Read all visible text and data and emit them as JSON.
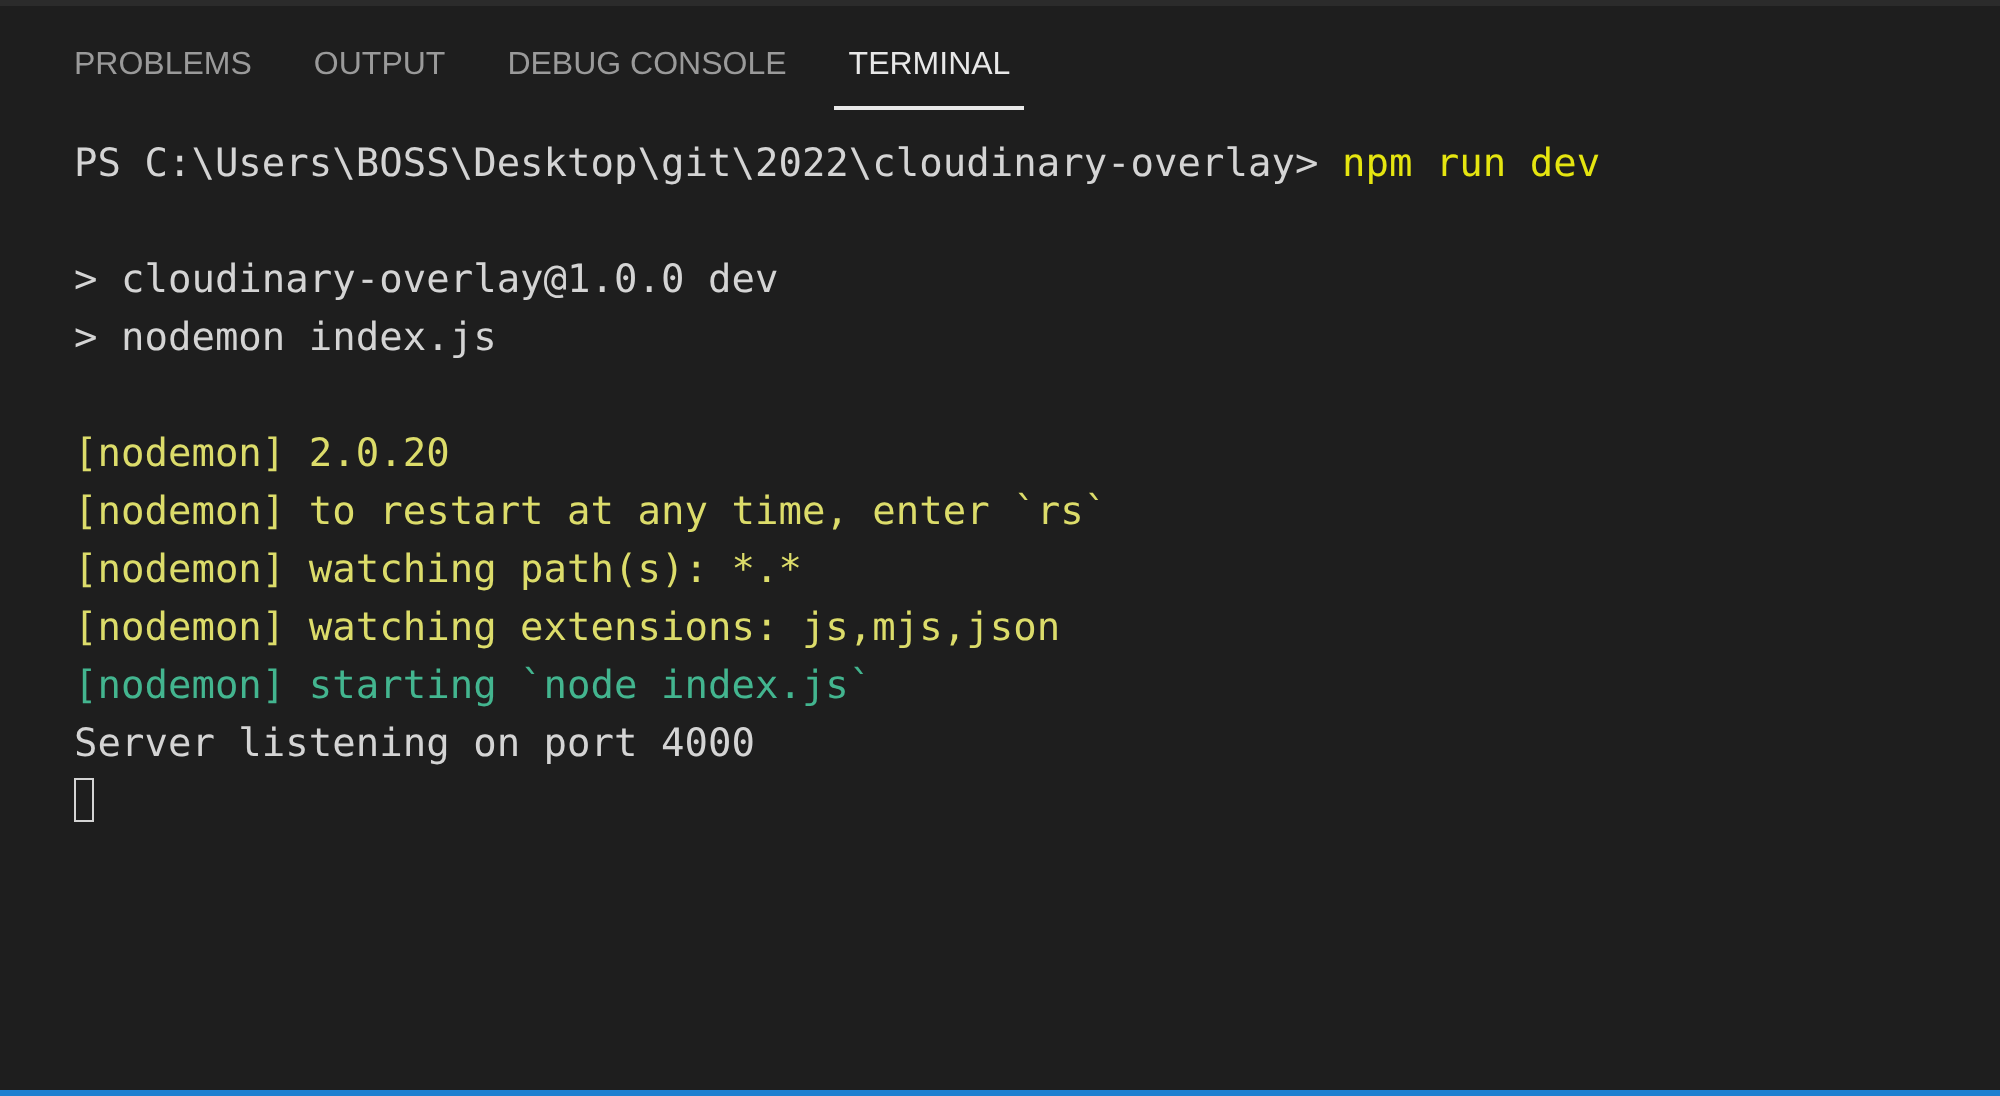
{
  "tabs": [
    {
      "label": "PROBLEMS",
      "selected": false
    },
    {
      "label": "OUTPUT",
      "selected": false
    },
    {
      "label": "DEBUG CONSOLE",
      "selected": false
    },
    {
      "label": "TERMINAL",
      "selected": true
    }
  ],
  "terminal": {
    "blocks": [
      [
        [
          {
            "kind": "prompt",
            "text": "PS C:\\Users\\BOSS\\Desktop\\git\\2022\\cloudinary-overlay> "
          },
          {
            "kind": "command",
            "text": "npm run dev"
          }
        ]
      ],
      [
        [
          {
            "kind": "plain",
            "text": "> cloudinary-overlay@1.0.0 dev"
          }
        ],
        [
          {
            "kind": "plain",
            "text": "> nodemon index.js"
          }
        ]
      ],
      [
        [
          {
            "kind": "warn",
            "text": "[nodemon] 2.0.20"
          }
        ],
        [
          {
            "kind": "warn",
            "text": "[nodemon] to restart at any time, enter `rs`"
          }
        ],
        [
          {
            "kind": "warn",
            "text": "[nodemon] watching path(s): *.*"
          }
        ],
        [
          {
            "kind": "warn",
            "text": "[nodemon] watching extensions: js,mjs,json"
          }
        ],
        [
          {
            "kind": "info",
            "text": "[nodemon] starting `node index.js`"
          }
        ],
        [
          {
            "kind": "plain",
            "text": "Server listening on port 4000"
          }
        ]
      ]
    ],
    "cursor_focused": false
  }
}
